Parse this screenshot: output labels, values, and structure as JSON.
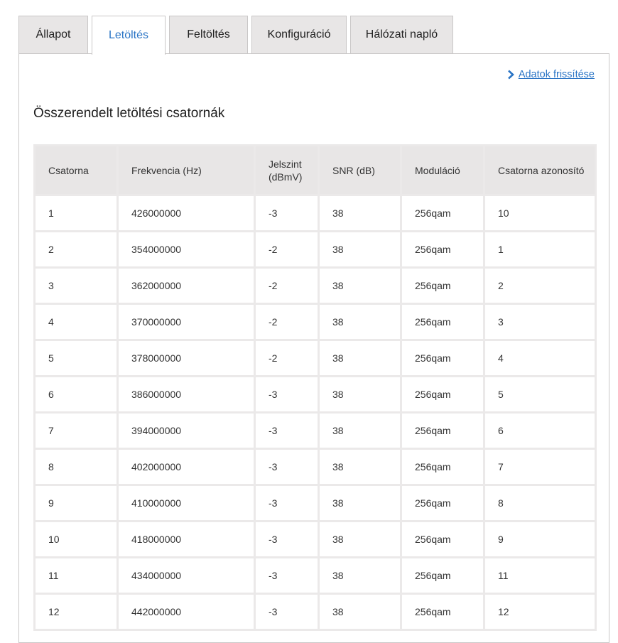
{
  "tabs": [
    {
      "label": "Állapot",
      "active": false
    },
    {
      "label": "Letöltés",
      "active": true
    },
    {
      "label": "Feltöltés",
      "active": false
    },
    {
      "label": "Konfiguráció",
      "active": false
    },
    {
      "label": "Hálózati napló",
      "active": false
    }
  ],
  "refresh": {
    "label": "Adatok frissítése",
    "icon": "chevron-right-icon"
  },
  "section_title": "Összerendelt letöltési csatornák",
  "table": {
    "headers": [
      "Csatorna",
      "Frekvencia (Hz)",
      "Jelszint (dBmV)",
      "SNR (dB)",
      "Moduláció",
      "Csatorna azonosító"
    ],
    "rows": [
      [
        "1",
        "426000000",
        "-3",
        "38",
        "256qam",
        "10"
      ],
      [
        "2",
        "354000000",
        "-2",
        "38",
        "256qam",
        "1"
      ],
      [
        "3",
        "362000000",
        "-2",
        "38",
        "256qam",
        "2"
      ],
      [
        "4",
        "370000000",
        "-2",
        "38",
        "256qam",
        "3"
      ],
      [
        "5",
        "378000000",
        "-2",
        "38",
        "256qam",
        "4"
      ],
      [
        "6",
        "386000000",
        "-3",
        "38",
        "256qam",
        "5"
      ],
      [
        "7",
        "394000000",
        "-3",
        "38",
        "256qam",
        "6"
      ],
      [
        "8",
        "402000000",
        "-3",
        "38",
        "256qam",
        "7"
      ],
      [
        "9",
        "410000000",
        "-3",
        "38",
        "256qam",
        "8"
      ],
      [
        "10",
        "418000000",
        "-3",
        "38",
        "256qam",
        "9"
      ],
      [
        "11",
        "434000000",
        "-3",
        "38",
        "256qam",
        "11"
      ],
      [
        "12",
        "442000000",
        "-3",
        "38",
        "256qam",
        "12"
      ]
    ]
  },
  "colors": {
    "accent": "#2a74c5",
    "tab_bg": "#e8e6e6",
    "border": "#c9c7c7"
  }
}
